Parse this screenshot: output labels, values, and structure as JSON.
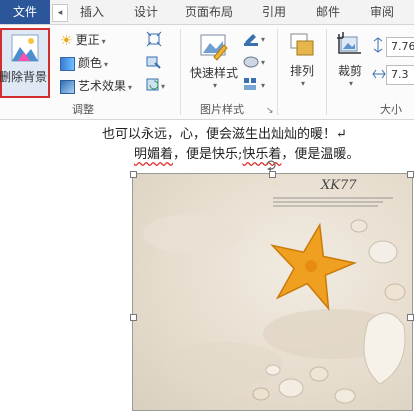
{
  "tabs": {
    "file": "文件",
    "scroll": "◂",
    "items": [
      "插入",
      "设计",
      "页面布局",
      "引用",
      "邮件",
      "审阅"
    ]
  },
  "ribbon": {
    "remove_background": "删除背景",
    "adjust": {
      "corrections": "更正",
      "color": "颜色",
      "artistic_effects": "艺术效果",
      "label": "调整"
    },
    "picture_styles": {
      "quick_styles": "快速样式",
      "label": "图片样式"
    },
    "arrange": "排列",
    "crop": "裁剪",
    "size": {
      "height": "7.76",
      "width": "7.3",
      "label": "大小"
    }
  },
  "document": {
    "line1": "也可以永远，心，便会滋生出灿灿的暖！↵",
    "line2_a": "明媚着",
    "line2_b": "，便是快乐;",
    "line2_c": "快乐着",
    "line2_d": "，便是温暖。",
    "photo_caption": "XK77"
  },
  "colors": {
    "file_tab": "#2b579a",
    "highlight_border": "#d32f2f",
    "starfish": "#f0a020"
  }
}
